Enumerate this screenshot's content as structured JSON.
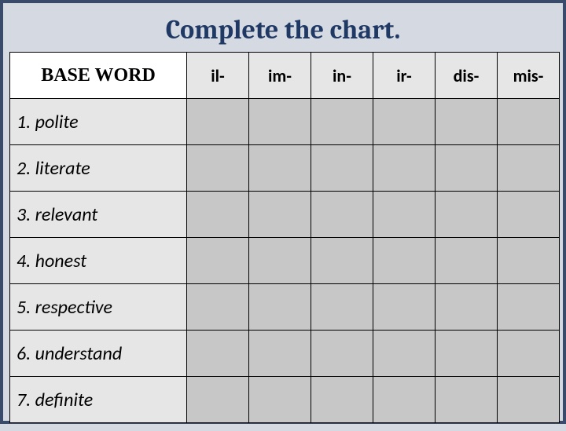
{
  "title": "Complete the chart.",
  "headers": {
    "base": "BASE WORD",
    "prefixes": [
      "il-",
      "im-",
      "in-",
      "ir-",
      "dis-",
      "mis-"
    ]
  },
  "rows": [
    {
      "label": "1. polite"
    },
    {
      "label": "2. literate"
    },
    {
      "label": "3. relevant"
    },
    {
      "label": "4. honest"
    },
    {
      "label": "5. respective"
    },
    {
      "label": "6. understand"
    },
    {
      "label": "7. definite"
    }
  ],
  "chart_data": {
    "type": "table",
    "title": "Complete the chart.",
    "columns": [
      "BASE WORD",
      "il-",
      "im-",
      "in-",
      "ir-",
      "dis-",
      "mis-"
    ],
    "rows": [
      [
        "1. polite",
        "",
        "",
        "",
        "",
        "",
        ""
      ],
      [
        "2. literate",
        "",
        "",
        "",
        "",
        "",
        ""
      ],
      [
        "3. relevant",
        "",
        "",
        "",
        "",
        "",
        ""
      ],
      [
        "4. honest",
        "",
        "",
        "",
        "",
        "",
        ""
      ],
      [
        "5. respective",
        "",
        "",
        "",
        "",
        "",
        ""
      ],
      [
        "6. understand",
        "",
        "",
        "",
        "",
        "",
        ""
      ],
      [
        "7. definite",
        "",
        "",
        "",
        "",
        "",
        ""
      ]
    ]
  }
}
